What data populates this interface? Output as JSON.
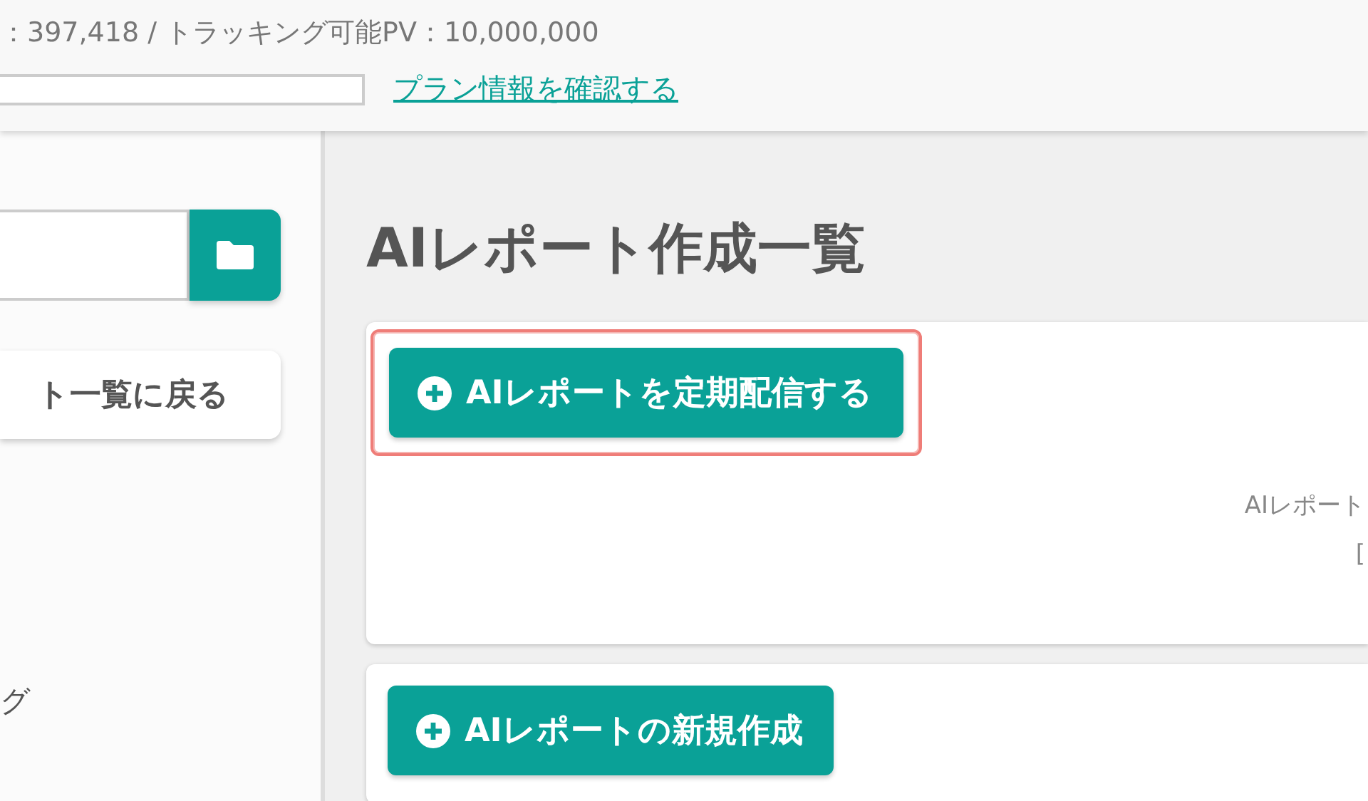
{
  "header": {
    "stats": "：397,418 / トラッキング可能PV：10,000,000",
    "plan_link": "プラン情報を確認する"
  },
  "sidebar": {
    "back_button": "ト一覧に戻る",
    "items": [
      {
        "label": "グ"
      }
    ]
  },
  "main": {
    "title": "AIレポート作成一覧",
    "cards": [
      {
        "button": "AIレポートを定期配信する",
        "focused": true,
        "lines": [
          "AIレポート",
          "["
        ]
      },
      {
        "button": "AIレポートの新規作成",
        "focused": false
      }
    ]
  }
}
